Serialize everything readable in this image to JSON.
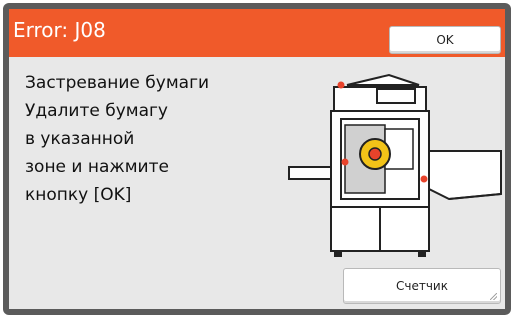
{
  "dialog": {
    "title": "Error: J08",
    "ok_label": "OK",
    "message_lines": [
      "Застревание бумаги",
      "Удалите бумагу",
      "в указанной",
      "зоне и нажмите",
      "кнопку [OK]"
    ],
    "counter_label": "Счетчик"
  },
  "colors": {
    "header": "#f05a2a",
    "frame": "#5b5b5b",
    "panel": "#e8e8e8",
    "highlight_dot": "#e8432b",
    "drum": "#f2c318"
  },
  "icons": [
    "printer-jam-illustration",
    "jam-location-marker",
    "resize-grip-icon"
  ]
}
